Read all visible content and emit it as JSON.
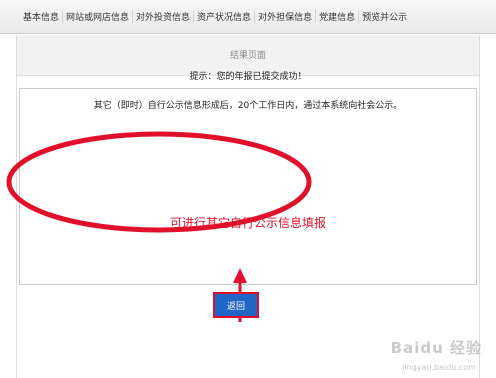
{
  "tabs": [
    "基本信息",
    "网站或网店信息",
    "对外投资信息",
    "资产状况信息",
    "对外担保信息",
    "党建信息",
    "预览并公示"
  ],
  "result_page_title": "结果页面",
  "message": {
    "title": "提示：您的年报已提交成功！",
    "body": "其它（即时）自行公示信息形成后，20个工作日内，通过本系统向社会公示。"
  },
  "annotation": {
    "text": "可进行其它自行公示信息填报",
    "color": "#e0102a"
  },
  "return_button_label": "返回",
  "colors": {
    "accent": "#1f66c6",
    "annotation_red": "#e0102a"
  },
  "watermark": {
    "text": "Baidu 经验",
    "sub": "jingyan.baidu.com"
  }
}
